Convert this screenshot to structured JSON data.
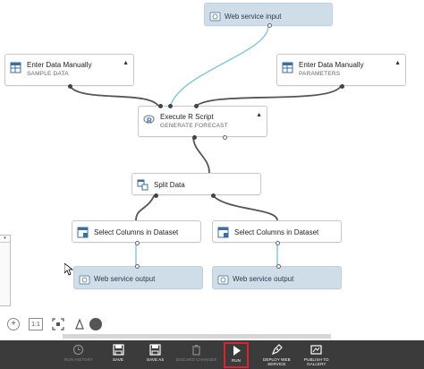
{
  "modules": {
    "web_service_input": {
      "title": "Web service input"
    },
    "enter_data_1": {
      "title": "Enter Data Manually",
      "subtitle": "SAMPLE DATA"
    },
    "enter_data_2": {
      "title": "Enter Data Manually",
      "subtitle": "PARAMETERS"
    },
    "execute_r": {
      "title": "Execute R Script",
      "subtitle": "GENERATE FORECAST"
    },
    "split_data": {
      "title": "Split Data"
    },
    "select_cols_1": {
      "title": "Select Columns in Dataset"
    },
    "select_cols_2": {
      "title": "Select Columns in Dataset"
    },
    "web_service_output_1": {
      "title": "Web service output"
    },
    "web_service_output_2": {
      "title": "Web service output"
    }
  },
  "zoom": {
    "fit_label": "1:1"
  },
  "toolbar": {
    "run_history": "RUN HISTORY",
    "save": "SAVE",
    "save_as": "SAVE AS",
    "discard_changes": "DISCARD CHANGES",
    "run": "RUN",
    "deploy_line1": "DEPLOY WEB",
    "deploy_line2": "SERVICE",
    "publish_line1": "PUBLISH TO",
    "publish_line2": "GALLERY"
  },
  "colors": {
    "toolbar_bg": "#3b3b3b",
    "web_service_module": "#cfdde8",
    "connector_blue": "#7fc4e0",
    "connector_gray": "#555555",
    "run_highlight": "#d9232f"
  },
  "icons": {
    "module": "table-icon",
    "r_script": "r-logo-icon",
    "web_service": "globe-icon",
    "run": "play-icon",
    "save": "floppy-disk-icon",
    "deploy": "pen-icon"
  }
}
